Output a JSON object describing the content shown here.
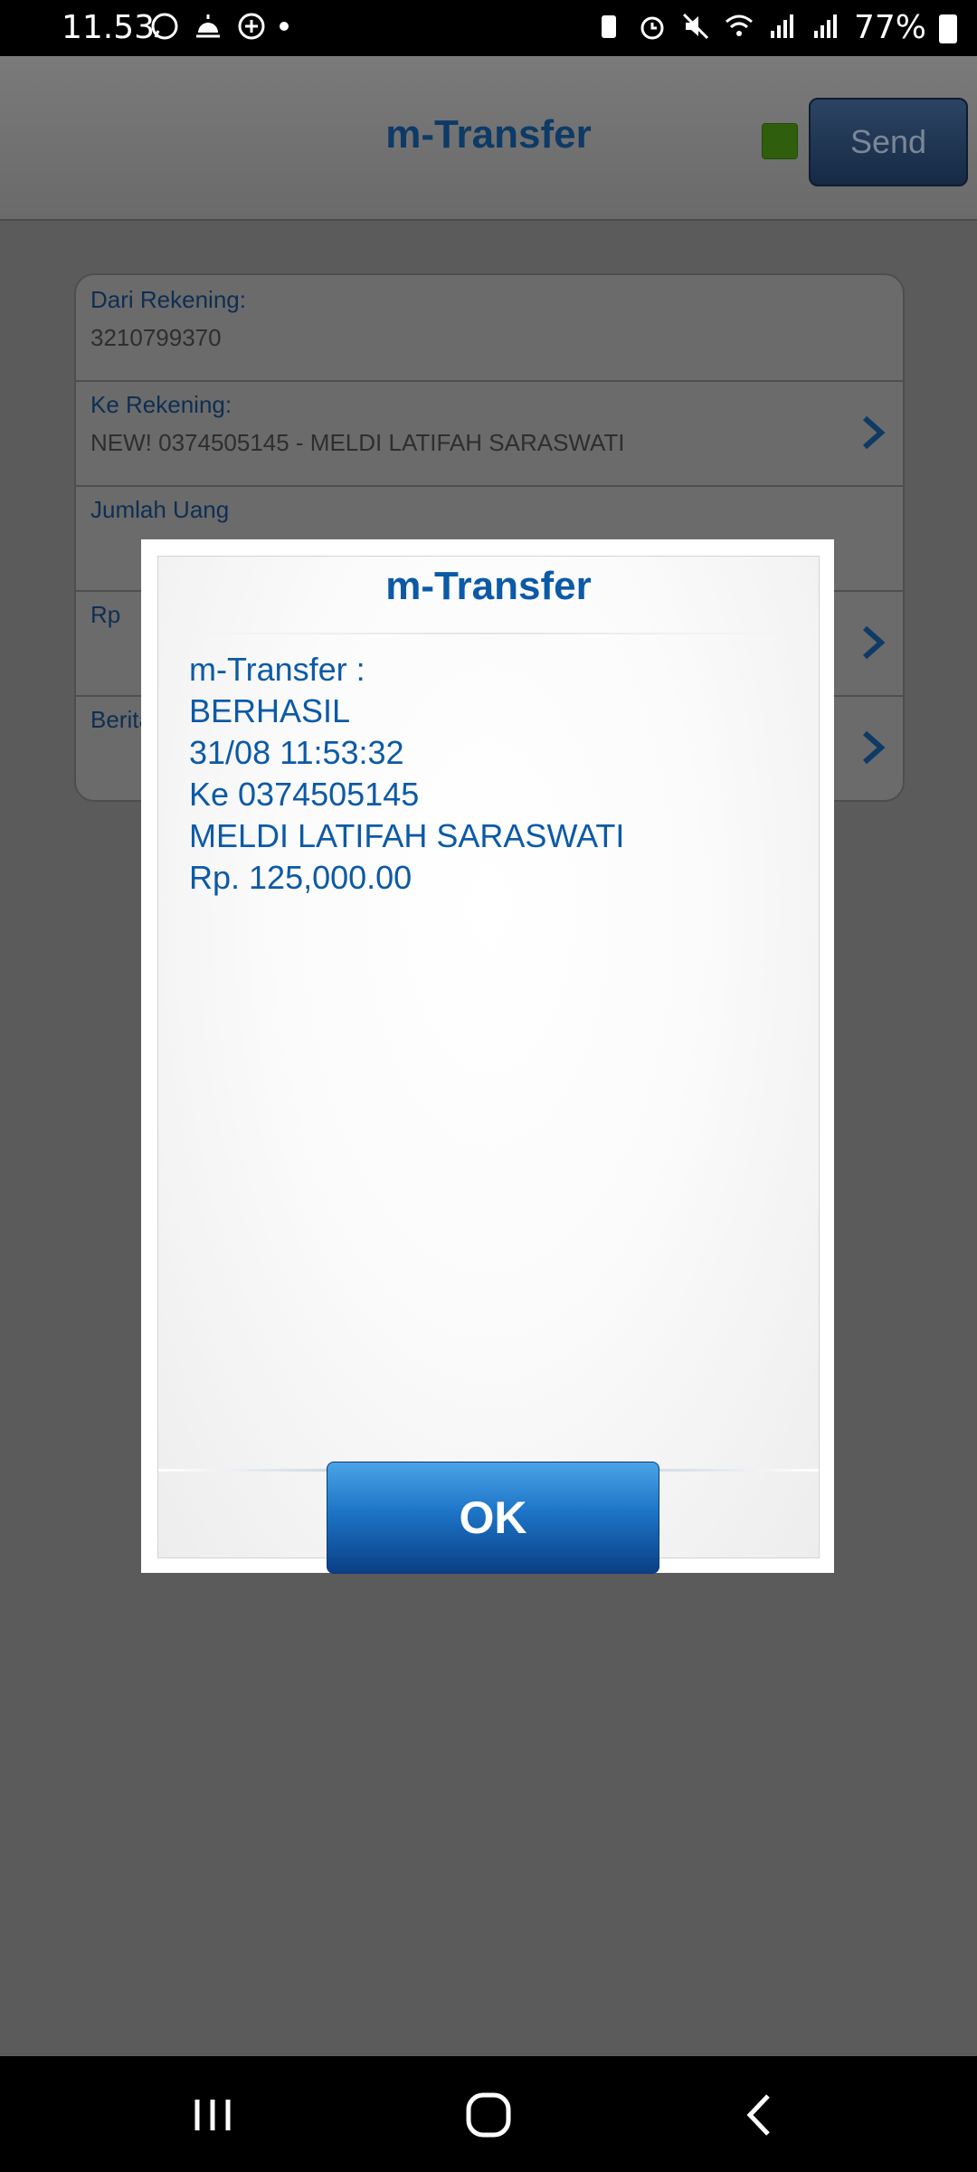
{
  "status_bar": {
    "time": "11.53",
    "battery": "77%"
  },
  "app": {
    "title": "m-Transfer",
    "send_label": "Send",
    "form": {
      "rows": [
        {
          "label": "Dari Rekening:",
          "value": "3210799370"
        },
        {
          "label": "Ke Rekening:",
          "value": "NEW! 0374505145 - MELDI LATIFAH SARASWATI"
        },
        {
          "label": "Jumlah Uang",
          "value": ""
        },
        {
          "label": "Rp",
          "value": ""
        },
        {
          "label": "Berita",
          "value": ""
        }
      ]
    }
  },
  "dialog": {
    "title": "m-Transfer",
    "lines": [
      "m-Transfer :",
      "BERHASIL",
      "31/08 11:53:32",
      "Ke 0374505145",
      "MELDI LATIFAH SARASWATI",
      "Rp. 125,000.00"
    ],
    "ok_label": "OK"
  },
  "colors": {
    "accent": "#0c5aa6",
    "ok_button": "#1d74c6"
  }
}
